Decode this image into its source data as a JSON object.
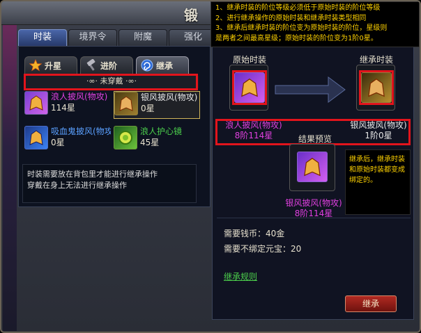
{
  "window": {
    "title": "锻"
  },
  "tooltip": {
    "lines": [
      "1、继承时装的阶位等级必须低于原始时装的阶位等级",
      "2、进行继承操作的原始时装和继承时装类型相同",
      "3、继承后继承时装的阶位变为原始时装的阶位，星级则",
      "是两者之间最高星级；原始时装的阶位变为1阶0星。"
    ]
  },
  "main_tabs": [
    {
      "label": "时装",
      "active": true
    },
    {
      "label": "境界令",
      "active": false
    },
    {
      "label": "附魔",
      "active": false
    },
    {
      "label": "强化",
      "active": false
    }
  ],
  "sub_tabs": [
    {
      "label": "升星",
      "icon": "star-icon",
      "active": false
    },
    {
      "label": "进阶",
      "icon": "hammer-icon",
      "active": false
    },
    {
      "label": "继承",
      "icon": "swirl-icon",
      "active": true
    }
  ],
  "section_label": "·∞· 未穿戴 ·∞·",
  "items": [
    {
      "name": "浪人披风(物攻)",
      "stars": "114星",
      "color": "purple",
      "thumb": "purple",
      "selected": false
    },
    {
      "name": "银风披风(物攻)",
      "stars": "0星",
      "color": "white",
      "thumb": "gold",
      "selected": true
    },
    {
      "name": "吸血鬼披风(物攻)",
      "stars": "0星",
      "color": "blue",
      "thumb": "blue",
      "selected": false
    },
    {
      "name": "浪人护心镜",
      "stars": "45星",
      "color": "green",
      "thumb": "green",
      "selected": false
    }
  ],
  "hint": {
    "line1": "时装需要放在背包里才能进行继承操作",
    "line2": "穿戴在身上无法进行继承操作"
  },
  "inherit": {
    "original_label": "原始时装",
    "target_label": "继承时装",
    "result_label": "结果预览",
    "original_name": "浪人披风(物攻)",
    "original_level": "8阶114星",
    "target_name": "银风披风(物攻)",
    "target_level": "1阶0星",
    "result_name": "银风披风(物攻)",
    "result_level": "8阶114星",
    "note": "继承后，继承时装和原始时装都变成绑定的。"
  },
  "costs": {
    "coin_label": "需要钱币：",
    "coin_value": "40金",
    "yuanbao_label": "需要不绑定元宝：",
    "yuanbao_value": "20"
  },
  "rules_link": "继承规则",
  "inherit_button": "继承",
  "colors": {
    "highlight_red": "#e2141c",
    "tooltip_yellow": "#ffd200",
    "item_purple": "#e040e0",
    "link_green": "#4cd04c"
  }
}
